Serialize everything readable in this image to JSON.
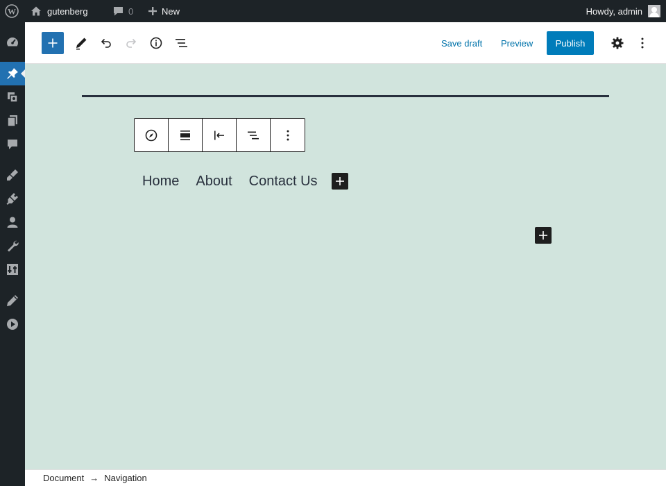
{
  "adminbar": {
    "site_name": "gutenberg",
    "comments_count": "0",
    "new_label": "New",
    "howdy": "Howdy, admin"
  },
  "adminmenu": {
    "items": [
      "dashboard-icon",
      "posts-icon",
      "media-icon",
      "pages-icon",
      "comments-icon",
      "appearance-icon",
      "plugins-icon",
      "users-icon",
      "tools-icon",
      "settings-icon",
      "gutenberg-icon",
      "media-play-icon"
    ],
    "active": "posts-icon"
  },
  "header": {
    "save_draft": "Save draft",
    "preview": "Preview",
    "publish": "Publish"
  },
  "block_toolbar": {
    "buttons": [
      "navigation-icon",
      "align-icon",
      "justify-left-icon",
      "item-justification-icon",
      "more-options-icon"
    ]
  },
  "navigation": {
    "links": [
      "Home",
      "About",
      "Contact Us"
    ]
  },
  "breadcrumb": {
    "root": "Document",
    "separator": "→",
    "current": "Navigation"
  },
  "colors": {
    "admin_dark": "#1d2327",
    "accent": "#2271b1",
    "publish": "#007cba",
    "canvas_bg": "#d1e4dd",
    "text_dark": "#28303d"
  }
}
